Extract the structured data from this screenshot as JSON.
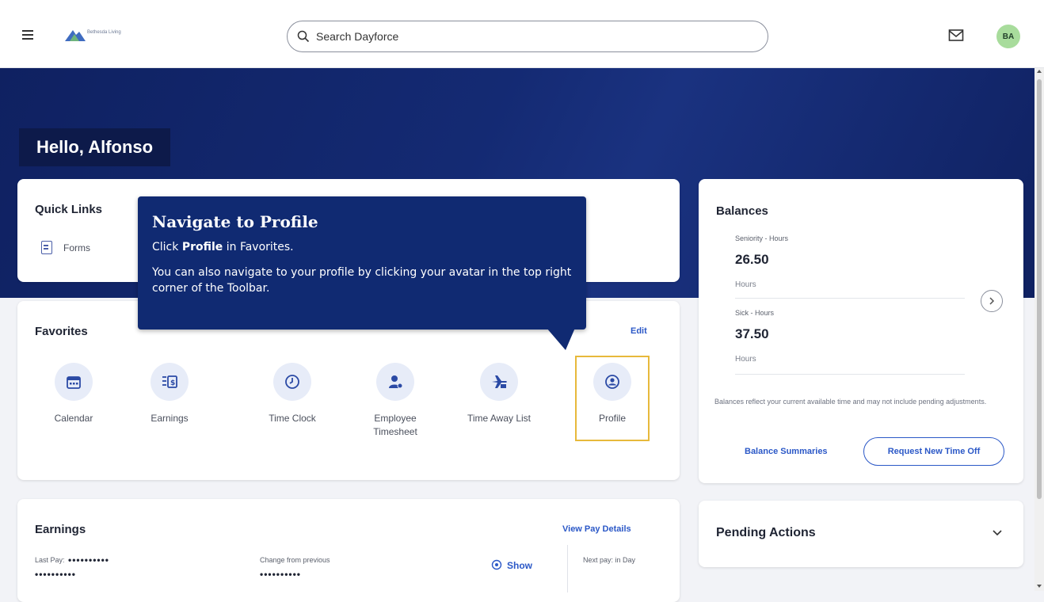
{
  "header": {
    "search_placeholder": "Search Dayforce",
    "avatar_initials": "BA",
    "logo_text": "Bethesda Living"
  },
  "banner": {
    "greeting": "Hello, Alfonso"
  },
  "quick_links": {
    "title": "Quick Links",
    "items": [
      {
        "label": "Forms",
        "icon": "form-icon"
      }
    ]
  },
  "tooltip": {
    "title": "Navigate to Profile",
    "line1_prefix": "Click ",
    "line1_bold": "Profile",
    "line1_suffix": " in Favorites.",
    "line2": "You can also navigate to your profile by clicking your avatar in the top right corner of the Toolbar."
  },
  "favorites": {
    "title": "Favorites",
    "edit_label": "Edit",
    "items": [
      {
        "label": "Calendar",
        "icon": "calendar-icon"
      },
      {
        "label": "Earnings",
        "icon": "earnings-icon"
      },
      {
        "label": "Time Clock",
        "icon": "clock-icon"
      },
      {
        "label": "Employee Timesheet",
        "icon": "employee-timesheet-icon"
      },
      {
        "label": "Time Away List",
        "icon": "plane-icon"
      },
      {
        "label": "Profile",
        "icon": "profile-icon"
      }
    ]
  },
  "earnings": {
    "title": "Earnings",
    "view_pay_details": "View Pay Details",
    "last_pay_label": "Last Pay:",
    "last_pay_masked": "••••••••••",
    "last_pay_masked_2": "••••••••••",
    "change_label": "Change from previous",
    "change_masked": "••••••••••",
    "show_label": "Show",
    "next_pay_label": "Next pay: in Day"
  },
  "balances": {
    "title": "Balances",
    "items": [
      {
        "label": "Seniority - Hours",
        "value": "26.50",
        "unit": "Hours"
      },
      {
        "label": "Sick - Hours",
        "value": "37.50",
        "unit": "Hours"
      }
    ],
    "note": "Balances reflect your current available time and may not include pending adjustments.",
    "summaries_label": "Balance Summaries",
    "request_label": "Request New Time Off"
  },
  "pending": {
    "title": "Pending Actions"
  },
  "colors": {
    "banner": "#0f2161",
    "tooltip": "#102a72",
    "link": "#2b58c7",
    "highlight": "#e7b93b",
    "avatar": "#a8dc9c"
  }
}
